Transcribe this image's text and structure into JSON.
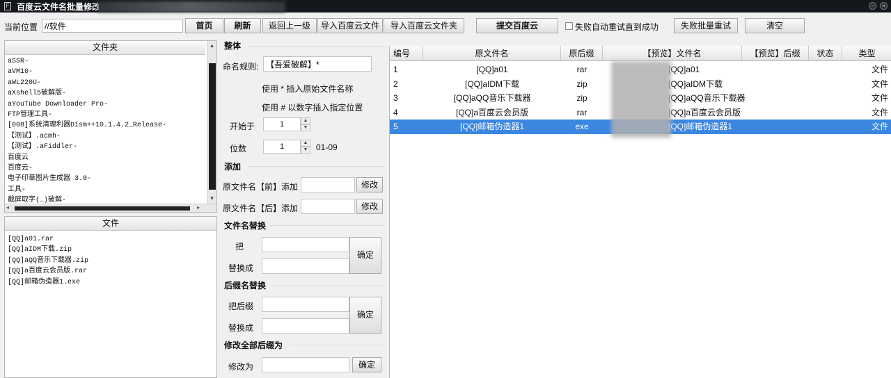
{
  "window": {
    "title": "百度云文件名批量修改"
  },
  "toolbar": {
    "path_label": "当前位置",
    "path_value": "//软件",
    "home": "首页",
    "refresh": "刷新",
    "up": "返回上一级",
    "import_file": "导入百度云文件",
    "import_folder": "导入百度云文件夹",
    "submit": "提交百度云",
    "retry_label": "失败自动重试直到成功",
    "retry_checked": false,
    "batch_retry": "失败批量重试",
    "clear": "清空"
  },
  "folders": {
    "header": "文件夹",
    "items": [
      "aSSR-",
      "aVM10-",
      "aWL220U-",
      "aXshell5破解版-",
      "aYouTube Downloader Pro-",
      "FTP管理工具-",
      "[008]系统清理利器Dism++10.1.4.2_Release-",
      "【测试】.acmh-",
      "【测试】.aFiddler-",
      "百度云",
      "百度云-",
      "电子印章图片生成器 3.0-",
      "工具-",
      "截屏取字(…)破解-"
    ]
  },
  "files": {
    "header": "文件",
    "items": [
      "[QQ]a01.rar",
      "[QQ]aIDM下载.zip",
      "[QQ]aQQ音乐下载器.zip",
      "[QQ]a百度云会员版.rar",
      "[QQ]邮箱伪造器1.exe"
    ]
  },
  "whole": {
    "title": "整体",
    "rule_label": "命名规则:",
    "rule_value": "【吾爱破解】*",
    "hint1": "使用 * 插入原始文件名称",
    "hint2": "使用 # 以数字插入指定位置",
    "start_label": "开始于",
    "start_value": "1",
    "digits_label": "位数",
    "digits_value": "1",
    "range": "01-09"
  },
  "add": {
    "title": "添加",
    "front_label": "原文件名【前】添加",
    "back_label": "原文件名【后】添加",
    "modify": "修改"
  },
  "replace_name": {
    "title": "文件名替换",
    "from_label": "把",
    "to_label": "替换成",
    "ok": "确定"
  },
  "replace_ext": {
    "title": "后缀名替换",
    "from_label": "把后缀",
    "to_label": "替换成",
    "ok": "确定"
  },
  "change_all_ext": {
    "title": "修改全部后缀为",
    "label": "修改为",
    "ok": "确定"
  },
  "table": {
    "columns": [
      "编号",
      "原文件名",
      "原后缀",
      "【预览】文件名",
      "【预览】后缀",
      "状态",
      "类型"
    ],
    "rows": [
      {
        "no": "1",
        "name": "[QQ]a01",
        "ext": "rar",
        "preview": "[QQ]a01",
        "type": "文件"
      },
      {
        "no": "2",
        "name": "[QQ]aIDM下载",
        "ext": "zip",
        "preview": "[QQ]aIDM下载",
        "type": "文件"
      },
      {
        "no": "3",
        "name": "[QQ]aQQ音乐下载器",
        "ext": "zip",
        "preview": "[QQ]aQQ音乐下载器",
        "type": "文件"
      },
      {
        "no": "4",
        "name": "[QQ]a百度云会员版",
        "ext": "rar",
        "preview": "[QQ]a百度云会员版",
        "type": "文件"
      },
      {
        "no": "5",
        "name": "[QQ]邮箱伪造器1",
        "ext": "exe",
        "preview": "[QQ]邮箱伪造器1",
        "type": "文件"
      }
    ],
    "selected_row": 5
  },
  "colors": {
    "selection": "#3a86e0",
    "titlebar": "#14181c"
  }
}
